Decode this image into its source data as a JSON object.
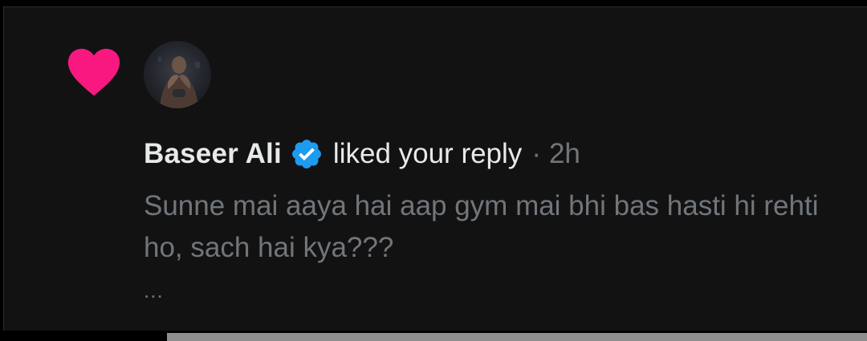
{
  "notification": {
    "type_icon": "heart-icon",
    "user": {
      "name": "Baseer Ali",
      "verified": true,
      "avatar_icon": "avatar"
    },
    "action": "liked your reply",
    "separator": "·",
    "time": "2h",
    "reply_text": "Sunne mai aaya hai aap gym mai bhi bas hasti hi rehti ho, sach hai kya???",
    "truncation": "..."
  },
  "colors": {
    "heart": "#f91880",
    "verified": "#1d9bf0",
    "background": "#121212",
    "primary_text": "#e7e9ea",
    "secondary_text": "#71767b"
  }
}
